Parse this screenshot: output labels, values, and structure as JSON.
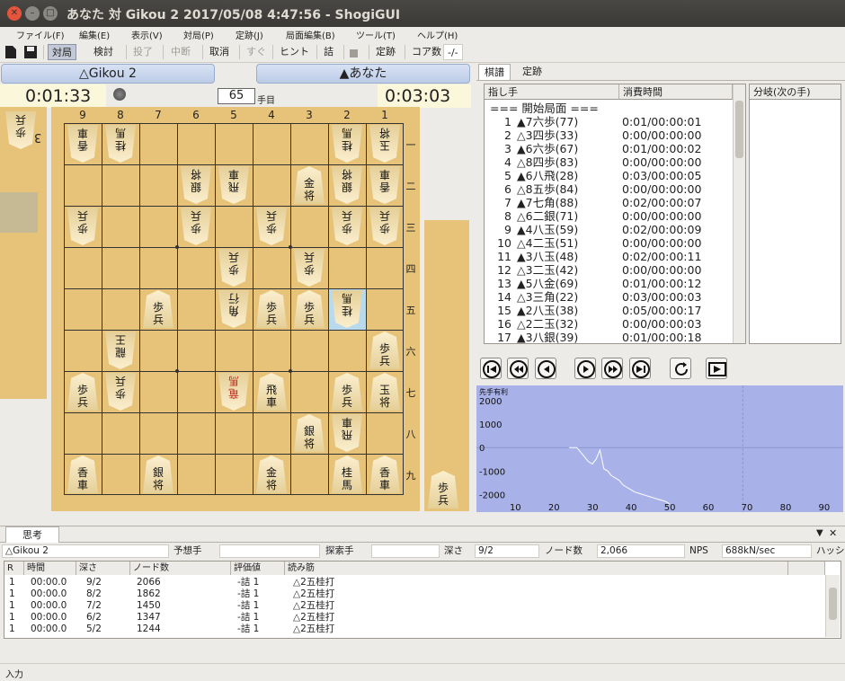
{
  "window": {
    "title": "あなた 対 Gikou 2 2017/05/08 4:47:56 - ShogiGUI"
  },
  "menu": [
    "ファイル(F)",
    "編集(E)",
    "表示(V)",
    "対局(P)",
    "定跡(J)",
    "局面編集(B)",
    "ツール(T)",
    "ヘルプ(H)"
  ],
  "toolbar": {
    "taikyoku": "対局",
    "kento": "検討",
    "touryo": "投了",
    "chudan": "中断",
    "torikeshi": "取消",
    "sugu": "すぐ",
    "hint": "ヒント",
    "tsume": "詰",
    "jouseki": "定跡",
    "core": "コア数",
    "core_value": "-/-"
  },
  "players": {
    "gote_name": "△Gikou 2",
    "sente_name": "▲あなた",
    "gote_time": "0:01:33",
    "sente_time": "0:03:03",
    "move_no": "65",
    "move_suffix": "手目"
  },
  "board": {
    "files": [
      "9",
      "8",
      "7",
      "6",
      "5",
      "4",
      "3",
      "2",
      "1"
    ],
    "ranks": [
      "一",
      "二",
      "三",
      "四",
      "五",
      "六",
      "七",
      "八",
      "九"
    ],
    "pieces": [
      {
        "f": 9,
        "r": 1,
        "t": "香車",
        "g": true
      },
      {
        "f": 8,
        "r": 1,
        "t": "桂馬",
        "g": true
      },
      {
        "f": 2,
        "r": 1,
        "t": "桂馬",
        "g": true
      },
      {
        "f": 1,
        "r": 1,
        "t": "玉将",
        "g": true
      },
      {
        "f": 6,
        "r": 2,
        "t": "銀将",
        "g": true
      },
      {
        "f": 5,
        "r": 2,
        "t": "飛車",
        "g": true
      },
      {
        "f": 3,
        "r": 2,
        "t": "金将",
        "g": false
      },
      {
        "f": 2,
        "r": 2,
        "t": "銀将",
        "g": true
      },
      {
        "f": 1,
        "r": 2,
        "t": "香車",
        "g": true
      },
      {
        "f": 9,
        "r": 3,
        "t": "歩兵",
        "g": true
      },
      {
        "f": 6,
        "r": 3,
        "t": "歩兵",
        "g": true
      },
      {
        "f": 4,
        "r": 3,
        "t": "歩兵",
        "g": true
      },
      {
        "f": 2,
        "r": 3,
        "t": "歩兵",
        "g": true
      },
      {
        "f": 1,
        "r": 3,
        "t": "歩兵",
        "g": true
      },
      {
        "f": 5,
        "r": 4,
        "t": "歩兵",
        "g": true
      },
      {
        "f": 3,
        "r": 4,
        "t": "歩兵",
        "g": true
      },
      {
        "f": 7,
        "r": 5,
        "t": "歩兵",
        "g": false
      },
      {
        "f": 5,
        "r": 5,
        "t": "角行",
        "g": true
      },
      {
        "f": 4,
        "r": 5,
        "t": "歩兵",
        "g": false
      },
      {
        "f": 3,
        "r": 5,
        "t": "歩兵",
        "g": false
      },
      {
        "f": 2,
        "r": 5,
        "t": "桂馬",
        "g": true,
        "hl": true
      },
      {
        "f": 8,
        "r": 6,
        "t": "龍王",
        "g": true
      },
      {
        "f": 1,
        "r": 6,
        "t": "歩兵",
        "g": false
      },
      {
        "f": 9,
        "r": 7,
        "t": "歩兵",
        "g": false
      },
      {
        "f": 8,
        "r": 7,
        "t": "歩兵",
        "g": true
      },
      {
        "f": 5,
        "r": 7,
        "t": "竜馬",
        "g": true,
        "pr": true
      },
      {
        "f": 4,
        "r": 7,
        "t": "飛車",
        "g": false
      },
      {
        "f": 2,
        "r": 7,
        "t": "歩兵",
        "g": false
      },
      {
        "f": 1,
        "r": 7,
        "t": "玉将",
        "g": false
      },
      {
        "f": 3,
        "r": 8,
        "t": "銀将",
        "g": false
      },
      {
        "f": 2,
        "r": 8,
        "t": "飛車",
        "g": true
      },
      {
        "f": 9,
        "r": 9,
        "t": "香車",
        "g": false
      },
      {
        "f": 7,
        "r": 9,
        "t": "銀将",
        "g": false
      },
      {
        "f": 4,
        "r": 9,
        "t": "金将",
        "g": false
      },
      {
        "f": 2,
        "r": 9,
        "t": "桂馬",
        "g": false
      },
      {
        "f": 1,
        "r": 9,
        "t": "香車",
        "g": false
      }
    ],
    "gote_hand": {
      "piece": "歩兵",
      "count": "3"
    },
    "sente_hand": {
      "piece": "歩兵"
    }
  },
  "kifu": {
    "tab_kifu": "棋譜",
    "tab_jouseki": "定跡",
    "col_move": "指し手",
    "col_time": "消費時間",
    "col_branch": "分岐(次の手)",
    "moves": [
      {
        "n": "",
        "m": "=== 開始局面 ===",
        "t": ""
      },
      {
        "n": "1",
        "m": "▲7六歩(77)",
        "t": "0:01/00:00:01"
      },
      {
        "n": "2",
        "m": "△3四歩(33)",
        "t": "0:00/00:00:00"
      },
      {
        "n": "3",
        "m": "▲6六歩(67)",
        "t": "0:01/00:00:02"
      },
      {
        "n": "4",
        "m": "△8四歩(83)",
        "t": "0:00/00:00:00"
      },
      {
        "n": "5",
        "m": "▲6八飛(28)",
        "t": "0:03/00:00:05"
      },
      {
        "n": "6",
        "m": "△8五歩(84)",
        "t": "0:00/00:00:00"
      },
      {
        "n": "7",
        "m": "▲7七角(88)",
        "t": "0:02/00:00:07"
      },
      {
        "n": "8",
        "m": "△6二銀(71)",
        "t": "0:00/00:00:00"
      },
      {
        "n": "9",
        "m": "▲4八玉(59)",
        "t": "0:02/00:00:09"
      },
      {
        "n": "10",
        "m": "△4二玉(51)",
        "t": "0:00/00:00:00"
      },
      {
        "n": "11",
        "m": "▲3八玉(48)",
        "t": "0:02/00:00:11"
      },
      {
        "n": "12",
        "m": "△3二玉(42)",
        "t": "0:00/00:00:00"
      },
      {
        "n": "13",
        "m": "▲5八金(69)",
        "t": "0:01/00:00:12"
      },
      {
        "n": "14",
        "m": "△3三角(22)",
        "t": "0:03/00:00:03"
      },
      {
        "n": "15",
        "m": "▲2八玉(38)",
        "t": "0:05/00:00:17"
      },
      {
        "n": "16",
        "m": "△2二玉(32)",
        "t": "0:00/00:00:03"
      },
      {
        "n": "17",
        "m": "▲3八銀(39)",
        "t": "0:01/00:00:18"
      }
    ]
  },
  "chart_data": {
    "type": "line",
    "title": "先手有利",
    "x": [
      24,
      25,
      26,
      27,
      28,
      29,
      30,
      31,
      32,
      33,
      34,
      35,
      36,
      37,
      38,
      39,
      40,
      41,
      42,
      43,
      44,
      45,
      46,
      47,
      48,
      49,
      50
    ],
    "y": [
      0,
      0,
      0,
      -200,
      -400,
      -600,
      -700,
      -500,
      -100,
      -900,
      -1000,
      -1200,
      -1300,
      -1400,
      -1600,
      -1700,
      -1800,
      -1900,
      -1950,
      -2000,
      -2050,
      -2100,
      -2150,
      -2200,
      -2250,
      -2300,
      -2400
    ],
    "xlim": [
      0,
      95
    ],
    "ylim": [
      -2600,
      2500
    ],
    "xticks": [
      "10",
      "20",
      "30",
      "40",
      "50",
      "60",
      "70",
      "80",
      "90"
    ],
    "yticks": [
      "2000",
      "1000",
      "0",
      "-1000",
      "-2000"
    ],
    "line_color": "#ffffff",
    "bg_color": "#a9b2e8"
  },
  "think": {
    "tab": "思考",
    "player": "△Gikou 2",
    "yoso_label": "予想手",
    "tansaku_label": "探索手",
    "depth_label": "深さ",
    "depth": "9/2",
    "nodes_label": "ノード数",
    "nodes": "2,066",
    "nps_label": "NPS",
    "nps": "688kN/sec",
    "hash_label": "ハッシ",
    "headers": [
      "R",
      "時間",
      "深さ",
      "ノード数",
      "評価値",
      "読み筋"
    ],
    "rows": [
      {
        "r": "1",
        "time": "00:00.0",
        "depth": "9/2",
        "nodes": "2066",
        "eval": "-詰 1",
        "pv": "△2五桂打"
      },
      {
        "r": "1",
        "time": "00:00.0",
        "depth": "8/2",
        "nodes": "1862",
        "eval": "-詰 1",
        "pv": "△2五桂打"
      },
      {
        "r": "1",
        "time": "00:00.0",
        "depth": "7/2",
        "nodes": "1450",
        "eval": "-詰 1",
        "pv": "△2五桂打"
      },
      {
        "r": "1",
        "time": "00:00.0",
        "depth": "6/2",
        "nodes": "1347",
        "eval": "-詰 1",
        "pv": "△2五桂打"
      },
      {
        "r": "1",
        "time": "00:00.0",
        "depth": "5/2",
        "nodes": "1244",
        "eval": "-詰 1",
        "pv": "△2五桂打"
      }
    ]
  },
  "status": {
    "text": "入力"
  },
  "colors": {
    "board": "#e7c37a",
    "highlight": "#b9d9ec",
    "titlebar": "#3d3b38"
  }
}
